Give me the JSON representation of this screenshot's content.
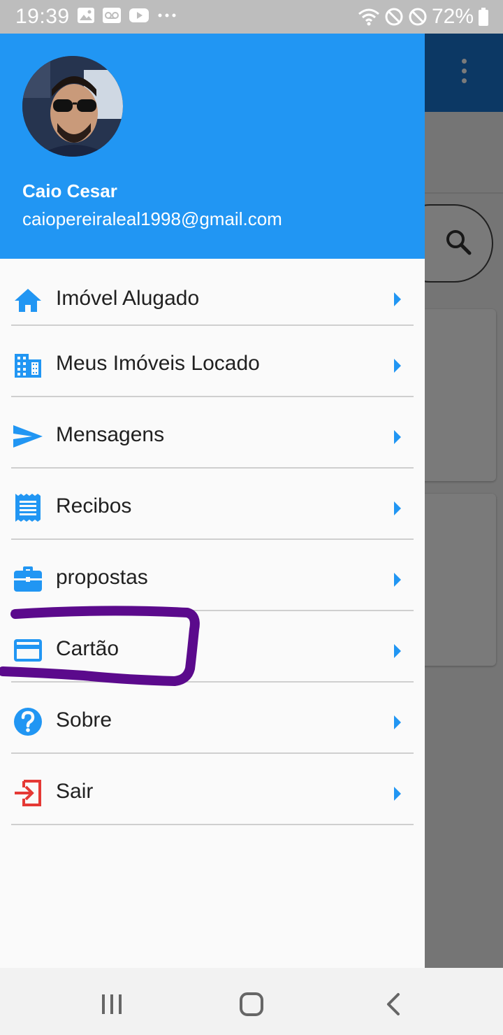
{
  "status_bar": {
    "time": "19:39",
    "battery": "72%",
    "left_icons": [
      "image-icon",
      "voicemail-icon",
      "youtube-icon",
      "more-notifications-icon"
    ],
    "right_icons": [
      "wifi-icon",
      "blocked-icon",
      "blocked-icon",
      "battery-icon"
    ]
  },
  "drawer": {
    "header_color": "#2196f3",
    "user": {
      "name": "Caio Cesar",
      "email": "caiopereiraleal1998@gmail.com"
    },
    "items": [
      {
        "label": "Imóvel Alugado",
        "icon": "home-icon",
        "icon_color": "#2196f3"
      },
      {
        "label": "Meus Imóveis Locado",
        "icon": "building-icon",
        "icon_color": "#2196f3"
      },
      {
        "label": "Mensagens",
        "icon": "send-icon",
        "icon_color": "#2196f3"
      },
      {
        "label": "Recibos",
        "icon": "receipt-icon",
        "icon_color": "#2196f3"
      },
      {
        "label": "propostas",
        "icon": "briefcase-icon",
        "icon_color": "#2196f3"
      },
      {
        "label": "Cartão",
        "icon": "credit-card-icon",
        "icon_color": "#2196f3"
      },
      {
        "label": "Sobre",
        "icon": "help-icon",
        "icon_color": "#2196f3"
      },
      {
        "label": "Sair",
        "icon": "exit-icon",
        "icon_color": "#e53935"
      }
    ]
  },
  "annotation": {
    "color": "#5b0a8c",
    "highlighted_item": "Cartão"
  },
  "background_app": {
    "appbar_color": "#1976d2",
    "search_icon": "search-icon",
    "overflow_icon": "more-vert-icon"
  },
  "nav_bar": {
    "buttons": [
      "recents-button",
      "home-button",
      "back-button"
    ]
  }
}
